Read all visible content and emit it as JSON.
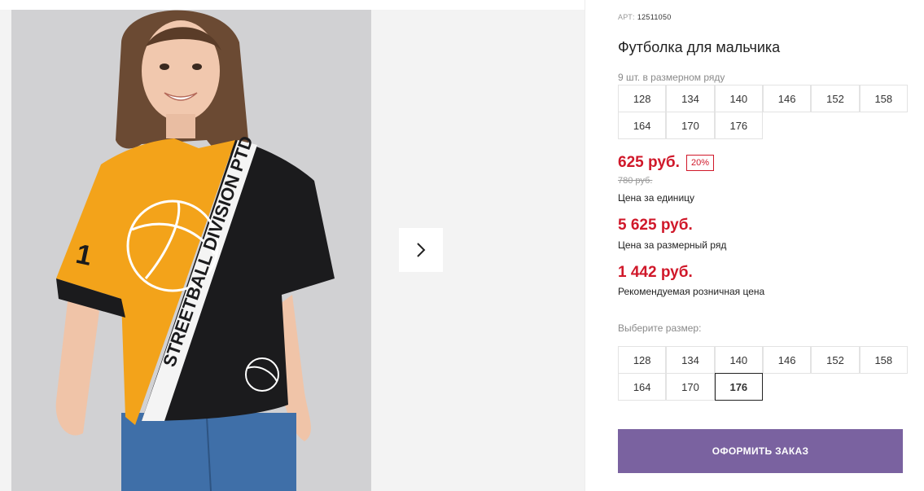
{
  "product": {
    "art_label": "АРТ:",
    "art_number": "12511050",
    "title": "Футболка для мальчика",
    "series_note": "9 шт. в размерном ряду"
  },
  "series_sizes": [
    "128",
    "134",
    "140",
    "146",
    "152",
    "158",
    "164",
    "170",
    "176"
  ],
  "price": {
    "current": "625 руб.",
    "discount": "20%",
    "old": "780 руб.",
    "unit_label": "Цена за единицу",
    "series_total": "5 625 руб.",
    "series_label": "Цена за размерный ряд",
    "retail": "1 442 руб.",
    "retail_label": "Рекомендуемая розничная цена"
  },
  "size_picker": {
    "label": "Выберите размер:",
    "sizes": [
      "128",
      "134",
      "140",
      "146",
      "152",
      "158",
      "164",
      "170",
      "176"
    ],
    "selected": "176"
  },
  "actions": {
    "order_label": "ОФОРМИТЬ ЗАКАЗ"
  },
  "shirt_print": {
    "text": "STREETBALL DIVISION PTD",
    "number": "1"
  },
  "colors": {
    "accent": "#7a62a0",
    "price": "#d0182a",
    "shirt_orange": "#f3a31a",
    "shirt_black": "#1b1b1d"
  }
}
